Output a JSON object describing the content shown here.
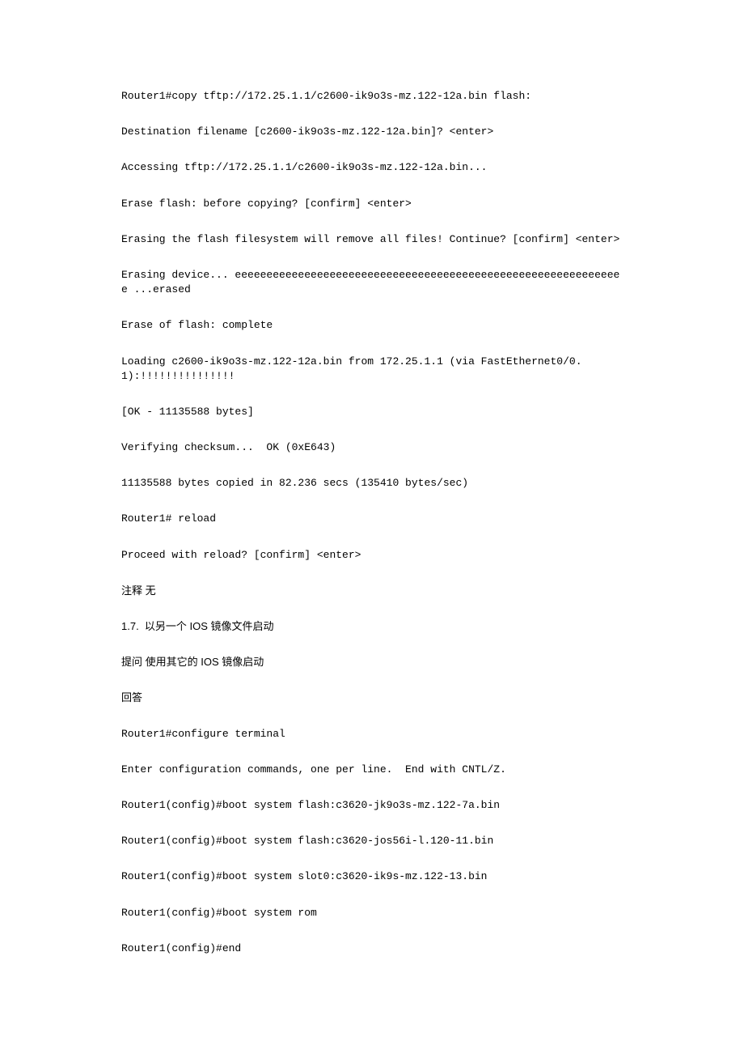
{
  "lines": [
    "Router1#copy tftp://172.25.1.1/c2600-ik9o3s-mz.122-12a.bin flash:",
    "Destination filename [c2600-ik9o3s-mz.122-12a.bin]? <enter>",
    "Accessing tftp://172.25.1.1/c2600-ik9o3s-mz.122-12a.bin...",
    "Erase flash: before copying? [confirm] <enter>",
    "Erasing the flash filesystem will remove all files! Continue? [confirm] <enter>",
    "Erasing device... eeeeeeeeeeeeeeeeeeeeeeeeeeeeeeeeeeeeeeeeeeeeeeeeeeeeeeeeeeeeee ...erased",
    "Erase of flash: complete",
    "Loading c2600-ik9o3s-mz.122-12a.bin from 172.25.1.1 (via FastEthernet0/0.1):!!!!!!!!!!!!!!!",
    "[OK - 11135588 bytes]",
    "Verifying checksum...  OK (0xE643)",
    "11135588 bytes copied in 82.236 secs (135410 bytes/sec)",
    "Router1# reload",
    "Proceed with reload? [confirm] <enter>",
    "注释 无",
    "1.7.  以另一个 IOS 镜像文件启动",
    "提问 使用其它的 IOS 镜像启动",
    "回答",
    "Router1#configure terminal",
    "Enter configuration commands, one per line.  End with CNTL/Z.",
    "Router1(config)#boot system flash:c3620-jk9o3s-mz.122-7a.bin",
    "Router1(config)#boot system flash:c3620-jos56i-l.120-11.bin",
    "Router1(config)#boot system slot0:c3620-ik9s-mz.122-13.bin",
    "Router1(config)#boot system rom",
    "Router1(config)#end"
  ]
}
